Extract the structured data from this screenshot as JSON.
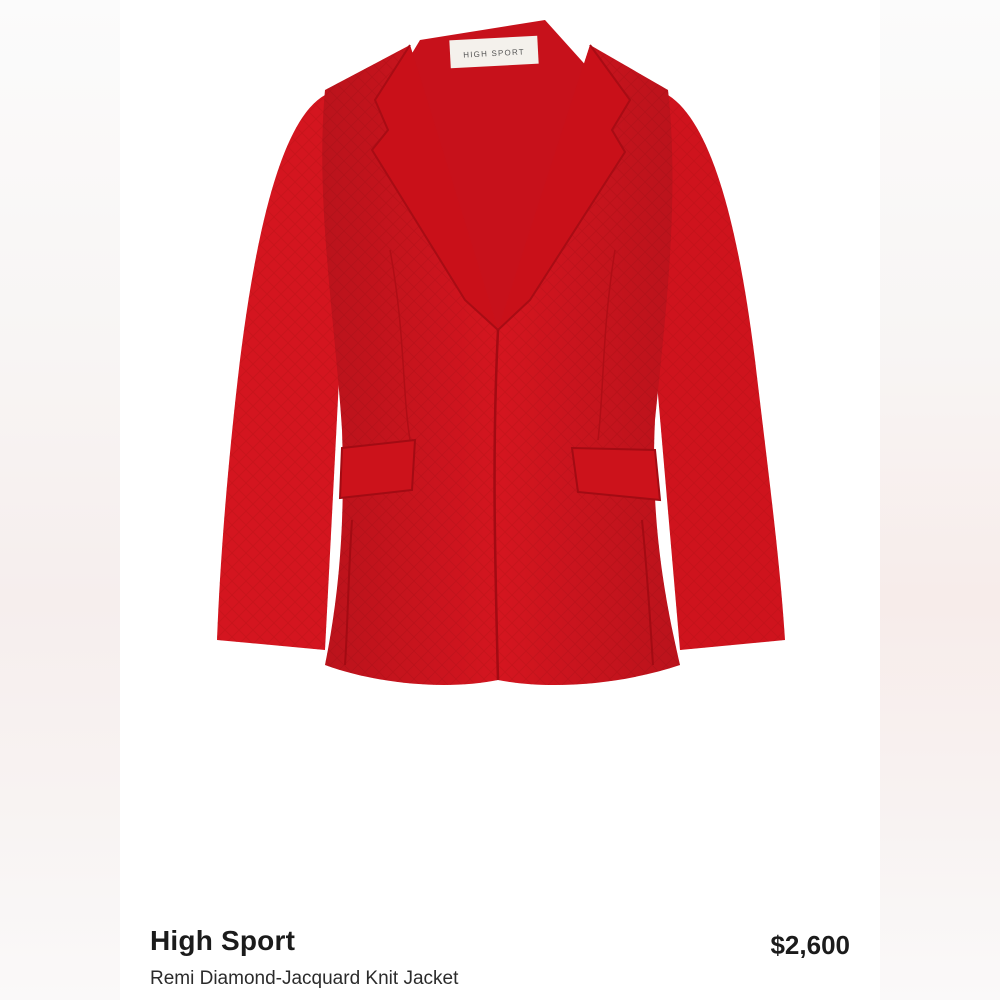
{
  "product": {
    "brand": "High Sport",
    "name": "Remi Diamond-Jacquard Knit Jacket",
    "price": "$2,600",
    "label_text": "HIGH SPORT",
    "color": "#d4151f"
  }
}
